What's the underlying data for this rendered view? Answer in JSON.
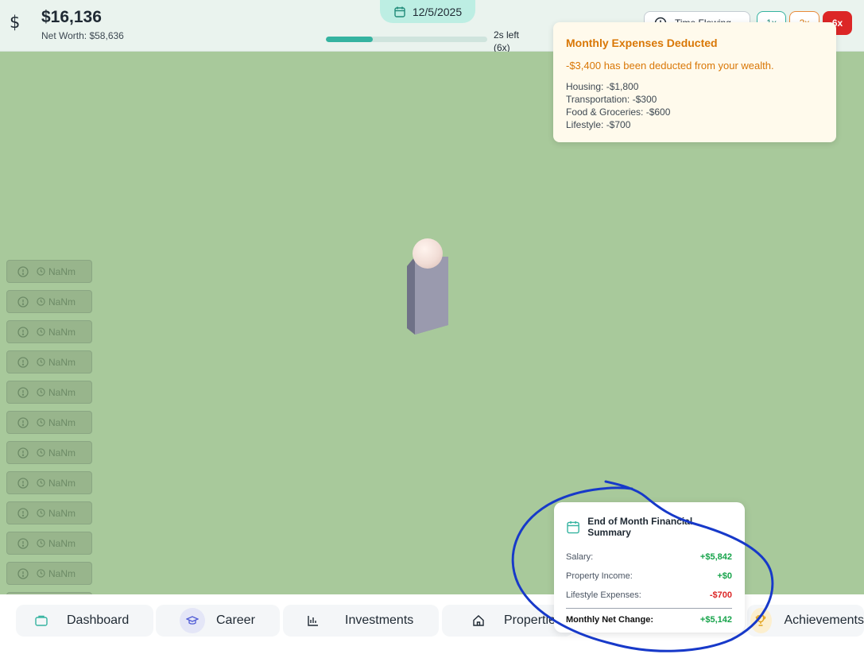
{
  "header": {
    "cash": "$16,136",
    "net_worth": "Net Worth: $58,636",
    "date": "12/5/2025",
    "progress": 0.29,
    "time_left_line1": "2s left",
    "time_left_line2": "(6x)",
    "time_flow_label": "Time Flowing",
    "speed_1": "1x",
    "speed_2": "2x",
    "speed_6": "6x"
  },
  "notifications": {
    "time_text": "NaNm",
    "count": 13
  },
  "toast": {
    "title": "Monthly Expenses Deducted",
    "message": "-$3,400 has been deducted from your wealth.",
    "lines": [
      "Housing: -$1,800",
      "Transportation: -$300",
      "Food & Groceries: -$600",
      "Lifestyle: -$700"
    ]
  },
  "summary": {
    "title": "End of Month Financial Summary",
    "rows": [
      {
        "label": "Salary:",
        "value": "+$5,842"
      },
      {
        "label": "Property Income:",
        "value": "+$0"
      },
      {
        "label": "Lifestyle Expenses:",
        "value": "-$700"
      }
    ],
    "total_label": "Monthly Net Change:",
    "total_value": "+$5,142"
  },
  "nav": {
    "dashboard": "Dashboard",
    "career": "Career",
    "investments": "Investments",
    "properties": "Properties",
    "achievements": "Achievements"
  },
  "colors": {
    "scene": "#a8c99b",
    "accent": "#35b3a0",
    "warning": "#d97706",
    "positive": "#16a34a",
    "negative": "#dc2626",
    "annotation": "#1739c9"
  }
}
